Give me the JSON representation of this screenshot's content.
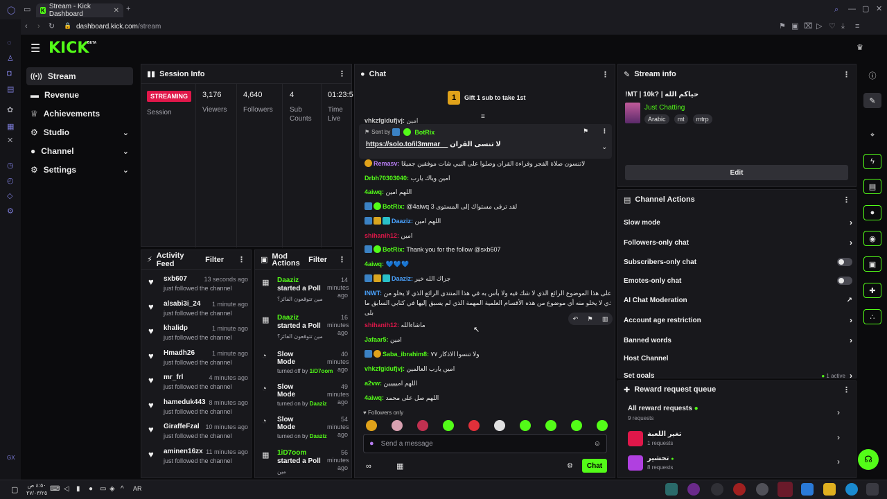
{
  "browser": {
    "tab_title": "Stream - Kick Dashboard",
    "tab_plus": "+",
    "url_host": "dashboard.kick.com",
    "url_path": "/stream"
  },
  "header": {
    "logo": "KICK",
    "beta": "BETA"
  },
  "nav": {
    "items": [
      {
        "label": "Stream",
        "icon": "broadcast-icon"
      },
      {
        "label": "Revenue",
        "icon": "wallet-icon"
      },
      {
        "label": "Achievements",
        "icon": "trophy-icon"
      },
      {
        "label": "Studio",
        "icon": "gear-icon"
      },
      {
        "label": "Channel",
        "icon": "person-icon"
      },
      {
        "label": "Settings",
        "icon": "gear-icon"
      }
    ]
  },
  "session": {
    "title": "Session Info",
    "badge": "STREAMING",
    "session_label": "Session",
    "viewers": "3,176",
    "viewers_label": "Viewers",
    "followers": "4,640",
    "followers_label": "Followers",
    "subs": "4",
    "subs_label1": "Sub",
    "subs_label2": "Counts",
    "time": "01:23:5",
    "time_label1": "Time",
    "time_label2": "Live"
  },
  "activity": {
    "title": "Activity Feed",
    "filter": "Filter",
    "items": [
      {
        "name": "sxb607",
        "time": "13 seconds ago",
        "sub": "just followed the channel"
      },
      {
        "name": "alsabi3i_24",
        "time": "1 minute ago",
        "sub": "just followed the channel"
      },
      {
        "name": "khalidp",
        "time": "1 minute ago",
        "sub": "just followed the channel"
      },
      {
        "name": "Hmadh26",
        "time": "1 minute ago",
        "sub": "just followed the channel"
      },
      {
        "name": "mr_frl",
        "time": "4 minutes ago",
        "sub": "just followed the channel"
      },
      {
        "name": "hameduk443",
        "time": "8 minutes ago",
        "sub": "just followed the channel"
      },
      {
        "name": "GiraffeFzal",
        "time": "10 minutes ago",
        "sub": "just followed the channel"
      },
      {
        "name": "aminen16zx",
        "time": "11 minutes ago",
        "sub": "just followed the channel"
      }
    ]
  },
  "mod": {
    "title1": "Mod",
    "title2": "Actions",
    "filter": "Filter",
    "items": [
      {
        "name": "Daaziz",
        "act1": "started a Poll",
        "act2": "",
        "time": "14 minutes ago",
        "sub": "مين تتوقعون الفائز؟",
        "by": ""
      },
      {
        "name": "Daaziz",
        "act1": "started a Poll",
        "act2": "",
        "time": "16 minutes ago",
        "sub": "مين تتوقعون الفائز؟",
        "by": ""
      },
      {
        "name": "",
        "act1": "Slow",
        "act2": "Mode",
        "time": "40 minutes ago",
        "sub": "turned off by",
        "by": "1iD7oom"
      },
      {
        "name": "",
        "act1": "Slow",
        "act2": "Mode",
        "time": "49 minutes ago",
        "sub": "turned on by",
        "by": "Daaziz"
      },
      {
        "name": "",
        "act1": "Slow",
        "act2": "Mode",
        "time": "54 minutes ago",
        "sub": "turned on by",
        "by": "Daaziz"
      },
      {
        "name": "1iD7oom",
        "act1": "started a Poll",
        "act2": "",
        "time": "56 minutes ago",
        "sub": "مين",
        "by": ""
      }
    ]
  },
  "chat": {
    "title": "Chat",
    "gift_count": "1",
    "gift_text": "Gift 1 sub to take 1st",
    "top_user": "vhkzfgidufjvj:",
    "top_msg": "امين",
    "pinned_sent_by": "Sent by",
    "pinned_user": "BotRix",
    "pinned_link": "https://solo.to/il3mmar__",
    "pinned_text": "لا تنسى القران",
    "messages": [
      {
        "user": "Remasv:",
        "color": "#b57cf0",
        "msg": "لاتنسون صلاة الفجر وقراءة القران وصلوا على النبي شات موفقين جميعًا",
        "badges": [
          "sub"
        ]
      },
      {
        "user": "Drbh70303040:",
        "color": "#53fc18",
        "msg": "امين وياك يارب",
        "badges": []
      },
      {
        "user": "4aiwq:",
        "color": "#53fc18",
        "msg": "اللهم امين",
        "badges": []
      },
      {
        "user": "BotRix:",
        "color": "#53fc18",
        "msg": "@4aiwq 3 لقد ترقى مستواك إلى المستوى",
        "badges": [
          "bot",
          "ver"
        ]
      },
      {
        "user": "Daaziz:",
        "color": "#4aa3ff",
        "msg": "اللهم امين",
        "badges": [
          "bot",
          "crown",
          "vip"
        ]
      },
      {
        "user": "shihanih12:",
        "color": "#e0174a",
        "msg": "امين",
        "badges": []
      },
      {
        "user": "BotRix:",
        "color": "#53fc18",
        "msg": "Thank you for the follow @sxb607",
        "badges": [
          "bot",
          "ver"
        ]
      },
      {
        "user": "4aiwq:",
        "color": "#53fc18",
        "msg": "💙💙💙",
        "badges": []
      },
      {
        "user": "Daaziz:",
        "color": "#4aa3ff",
        "msg": "جزاك الله خير",
        "badges": [
          "bot",
          "crown",
          "vip"
        ]
      }
    ],
    "long_user": "INWT:",
    "long_line1": "جزاك الله خيرا على هذا الموضوع الرائع الذي لا شك فيه ولا بأس به في هذا المنتدى الرائع الذي لا يخلو من",
    "long_line2": "أسرار من هذا الباب الذي لا يخلو منه أي موضوع من هذه الأقسام العلمية المهمة الذي لم يسبق إليها في كتابي السابق ما",
    "long_line3": "بلى",
    "messages2": [
      {
        "user": "shihanih12:",
        "color": "#e0174a",
        "msg": "ماشاءالله",
        "badges": []
      },
      {
        "user": "Jafaar5:",
        "color": "#53fc18",
        "msg": "امين",
        "badges": []
      },
      {
        "user": "Saba_ibrahim8:",
        "color": "#53fc18",
        "msg": "ولا تنسوا الاذكار ٧٧",
        "badges": [
          "bot",
          "sub"
        ]
      },
      {
        "user": "vhkzfgidufjvj:",
        "color": "#53fc18",
        "msg": "امين يارب العالمين",
        "badges": []
      },
      {
        "user": "a2vw:",
        "color": "#53fc18",
        "msg": "اللهم امييييين",
        "badges": []
      },
      {
        "user": "4aiwq:",
        "color": "#53fc18",
        "msg": "اللهم صل على محمد",
        "badges": []
      }
    ],
    "followers_only": "Followers only",
    "placeholder": "Send a message",
    "chat_button": "Chat"
  },
  "stream_info": {
    "title": "Stream info",
    "stream_title": "!MT | 10k? | حياكم الله",
    "category": "Just Chatting",
    "tags": [
      "Arabic",
      "mt",
      "mtrp"
    ],
    "edit": "Edit"
  },
  "channel_actions": {
    "title": "Channel Actions",
    "rows": [
      {
        "label": "Slow mode",
        "kind": "chevron"
      },
      {
        "label": "Followers-only chat",
        "kind": "chevron"
      },
      {
        "label": "Subscribers-only chat",
        "kind": "toggle"
      },
      {
        "label": "Emotes-only chat",
        "kind": "toggle"
      },
      {
        "label": "AI Chat Moderation",
        "kind": "external"
      },
      {
        "label": "Account age restriction",
        "kind": "chevron"
      },
      {
        "label": "Banned words",
        "kind": "chevron"
      },
      {
        "label": "Host Channel",
        "kind": "none"
      },
      {
        "label": "Set goals",
        "kind": "chevron",
        "note": "1 active"
      }
    ]
  },
  "reward": {
    "title": "Reward request queue",
    "all_label": "All reward requests",
    "all_count": "9 requests",
    "items": [
      {
        "label": "تغير اللعبة",
        "count": "1 requests",
        "color": "#e0174a"
      },
      {
        "label": "تحشير",
        "count": "8 requests",
        "color": "#b040e0"
      }
    ]
  },
  "taskbar": {
    "time": "٤:٥٠ ص",
    "date": "٢٧/٠٣/٢٥",
    "lang": "AR"
  }
}
